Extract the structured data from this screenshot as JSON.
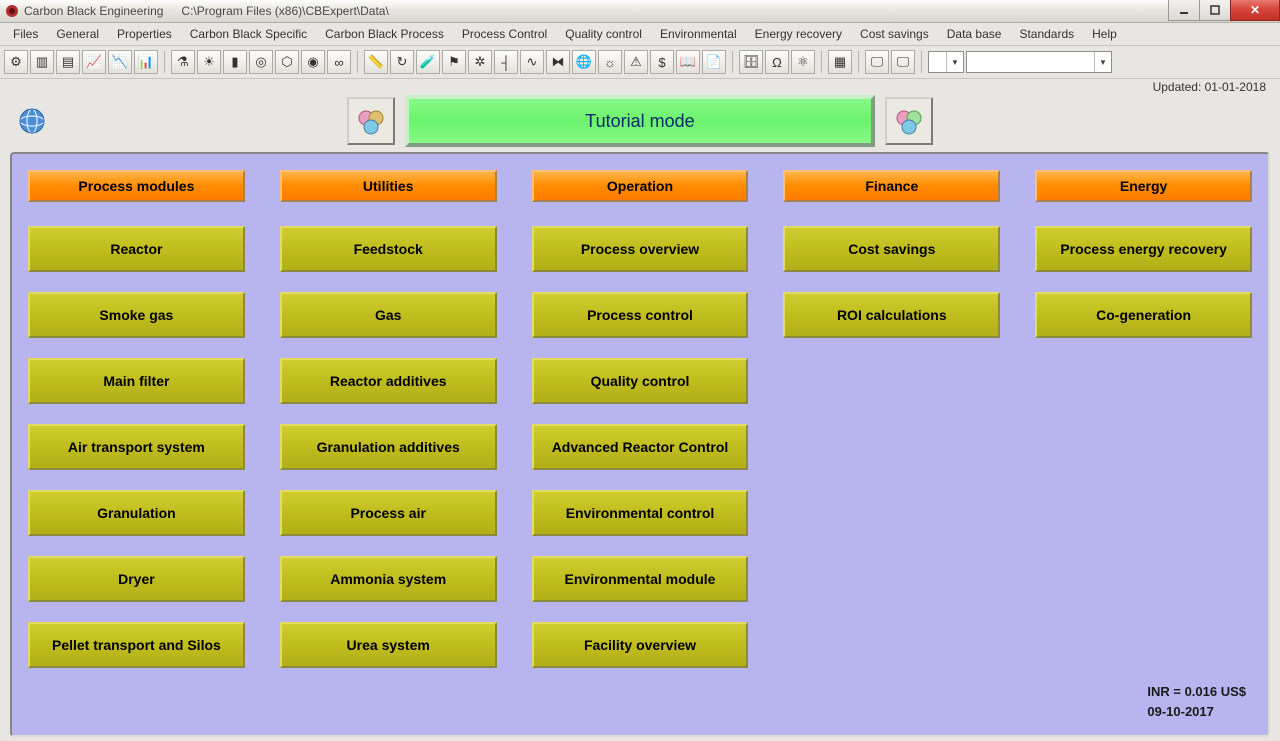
{
  "titlebar": {
    "app_name": "Carbon Black Engineering",
    "path": "C:\\Program Files (x86)\\CBExpert\\Data\\"
  },
  "menu": [
    "Files",
    "General",
    "Properties",
    "Carbon Black Specific",
    "Carbon Black Process",
    "Process Control",
    "Quality control",
    "Environmental",
    "Energy recovery",
    "Cost savings",
    "Data base",
    "Standards",
    "Help"
  ],
  "toolbar_groups": [
    [
      {
        "name": "gear-icon",
        "glyph": "⚙"
      },
      {
        "name": "panel-icon",
        "glyph": "▥"
      },
      {
        "name": "bars-icon",
        "glyph": "▤"
      },
      {
        "name": "chart-line-icon",
        "glyph": "📈"
      },
      {
        "name": "chart-area-icon",
        "glyph": "📉"
      },
      {
        "name": "chart-bar-icon",
        "glyph": "📊"
      }
    ],
    [
      {
        "name": "flask-icon",
        "glyph": "⚗"
      },
      {
        "name": "sun-icon",
        "glyph": "☀"
      },
      {
        "name": "column-icon",
        "glyph": "▮"
      },
      {
        "name": "ring-icon",
        "glyph": "◎"
      },
      {
        "name": "hex-icon",
        "glyph": "⬡"
      },
      {
        "name": "target-icon",
        "glyph": "◉"
      },
      {
        "name": "link-icon",
        "glyph": "∞"
      }
    ],
    [
      {
        "name": "ruler-icon",
        "glyph": "📏"
      },
      {
        "name": "loop-icon",
        "glyph": "↻"
      },
      {
        "name": "lab-icon",
        "glyph": "🧪"
      },
      {
        "name": "flag-icon",
        "glyph": "⚑"
      },
      {
        "name": "fan-icon",
        "glyph": "✲"
      },
      {
        "name": "probe-icon",
        "glyph": "┤"
      },
      {
        "name": "wave-icon",
        "glyph": "∿"
      },
      {
        "name": "chain-icon",
        "glyph": "⧓"
      },
      {
        "name": "globe2-icon",
        "glyph": "🌐"
      },
      {
        "name": "sun2-icon",
        "glyph": "☼"
      },
      {
        "name": "warn-icon",
        "glyph": "⚠"
      },
      {
        "name": "dollar-icon",
        "glyph": "$"
      },
      {
        "name": "book-icon",
        "glyph": "📖"
      },
      {
        "name": "doc-icon",
        "glyph": "📄"
      }
    ],
    [
      {
        "name": "db-icon",
        "glyph": "🗄"
      },
      {
        "name": "horseshoe-icon",
        "glyph": "Ω"
      },
      {
        "name": "atom-icon",
        "glyph": "⚛"
      }
    ],
    [
      {
        "name": "sheet-icon",
        "glyph": "▦"
      }
    ],
    [
      {
        "name": "monitor1-icon",
        "glyph": "🖵"
      },
      {
        "name": "monitor2-icon",
        "glyph": "🖵"
      }
    ]
  ],
  "toolbar_combo1": "",
  "toolbar_combo2": "",
  "updated": "Updated: 01-01-2018",
  "mode_label": "Tutorial mode",
  "columns": [
    {
      "header": "Process modules",
      "buttons": [
        "Reactor",
        "Smoke gas",
        "Main filter",
        "Air transport system",
        "Granulation",
        "Dryer",
        "Pellet transport and Silos"
      ]
    },
    {
      "header": "Utilities",
      "buttons": [
        "Feedstock",
        "Gas",
        "Reactor additives",
        "Granulation additives",
        "Process air",
        "Ammonia system",
        "Urea system"
      ]
    },
    {
      "header": "Operation",
      "buttons": [
        "Process overview",
        "Process control",
        "Quality control",
        "Advanced Reactor Control",
        "Environmental control",
        "Environmental module",
        "Facility overview"
      ]
    },
    {
      "header": "Finance",
      "buttons": [
        "Cost savings",
        "ROI calculations"
      ]
    },
    {
      "header": "Energy",
      "buttons": [
        "Process energy recovery",
        "Co-generation"
      ]
    }
  ],
  "footer": {
    "rate": "INR = 0.016 US$",
    "date": "09-10-2017"
  }
}
